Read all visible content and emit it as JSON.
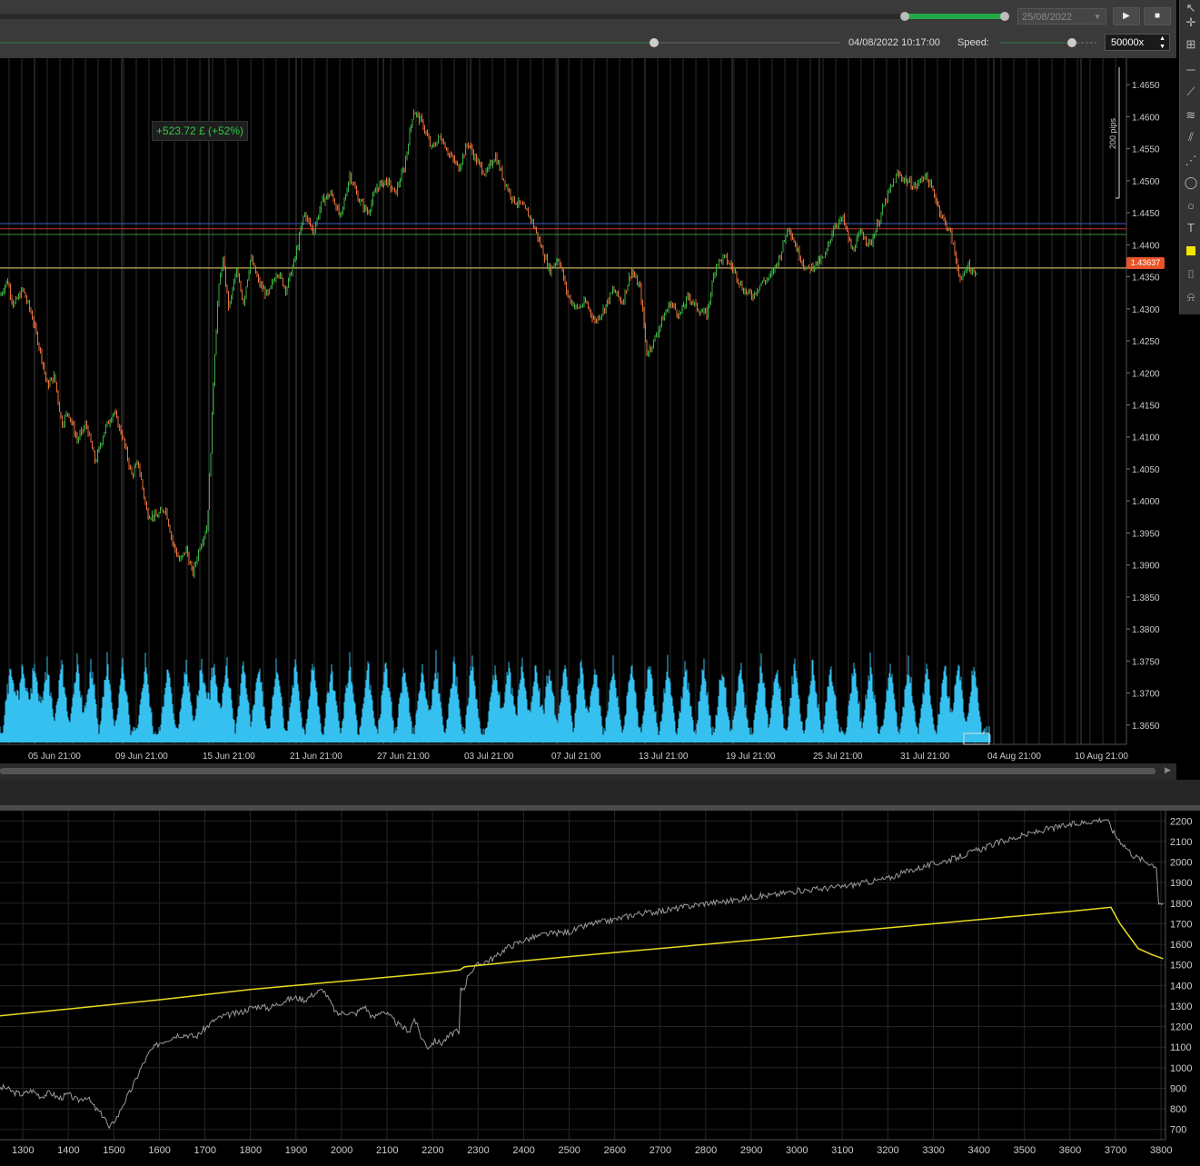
{
  "playback": {
    "end_date": "25/08/2022",
    "current_datetime": "04/08/2022 10:17:00",
    "speed_label": "Speed:",
    "speed_value": "50000x",
    "play_icon": "play-icon",
    "stop_icon": "stop-icon"
  },
  "trade_result": "+523.72 £ (+52%)",
  "price_chart": {
    "current_price": "1.43637",
    "pips_label": "200 pips",
    "y_ticks": [
      "1.4650",
      "1.4600",
      "1.4550",
      "1.4500",
      "1.4450",
      "1.4400",
      "1.4350",
      "1.4300",
      "1.4250",
      "1.4200",
      "1.4150",
      "1.4100",
      "1.4050",
      "1.4000",
      "1.3950",
      "1.3900",
      "1.3850",
      "1.3800",
      "1.3750",
      "1.3700",
      "1.3650"
    ],
    "x_ticks": [
      "05 Jun 21:00",
      "09 Jun 21:00",
      "15 Jun 21:00",
      "21 Jun 21:00",
      "27 Jun 21:00",
      "03 Jul 21:00",
      "07 Jul 21:00",
      "13 Jul 21:00",
      "19 Jul 21:00",
      "25 Jul 21:00",
      "31 Jul 21:00",
      "04 Aug 21:00",
      "10 Aug 21:00"
    ],
    "colors": {
      "up": "#3cb043",
      "down": "#e8703a",
      "volume": "#35c0ef",
      "blue_line": "#3f51b5",
      "red_line": "#c0392b",
      "green_line": "#3c8a3c",
      "price_line": "#c8b060"
    },
    "price_path": [
      [
        0,
        1.432
      ],
      [
        8,
        1.4345
      ],
      [
        15,
        1.4305
      ],
      [
        25,
        1.433
      ],
      [
        35,
        1.429
      ],
      [
        45,
        1.423
      ],
      [
        52,
        1.418
      ],
      [
        60,
        1.4195
      ],
      [
        68,
        1.412
      ],
      [
        75,
        1.414
      ],
      [
        85,
        1.4095
      ],
      [
        95,
        1.412
      ],
      [
        105,
        1.406
      ],
      [
        115,
        1.411
      ],
      [
        125,
        1.414
      ],
      [
        135,
        1.41
      ],
      [
        145,
        1.404
      ],
      [
        152,
        1.406
      ],
      [
        162,
        1.398
      ],
      [
        172,
        1.3975
      ],
      [
        182,
        1.399
      ],
      [
        190,
        1.3935
      ],
      [
        198,
        1.3905
      ],
      [
        205,
        1.3925
      ],
      [
        212,
        1.3885
      ],
      [
        220,
        1.393
      ],
      [
        228,
        1.396
      ],
      [
        232,
        1.408
      ],
      [
        236,
        1.422
      ],
      [
        240,
        1.432
      ],
      [
        245,
        1.438
      ],
      [
        252,
        1.43
      ],
      [
        260,
        1.436
      ],
      [
        268,
        1.431
      ],
      [
        276,
        1.438
      ],
      [
        285,
        1.434
      ],
      [
        295,
        1.432
      ],
      [
        305,
        1.436
      ],
      [
        315,
        1.433
      ],
      [
        325,
        1.438
      ],
      [
        335,
        1.445
      ],
      [
        345,
        1.442
      ],
      [
        355,
        1.447
      ],
      [
        365,
        1.448
      ],
      [
        375,
        1.444
      ],
      [
        385,
        1.451
      ],
      [
        395,
        1.447
      ],
      [
        405,
        1.445
      ],
      [
        415,
        1.449
      ],
      [
        425,
        1.45
      ],
      [
        435,
        1.448
      ],
      [
        445,
        1.452
      ],
      [
        455,
        1.461
      ],
      [
        465,
        1.459
      ],
      [
        475,
        1.455
      ],
      [
        485,
        1.457
      ],
      [
        495,
        1.454
      ],
      [
        505,
        1.452
      ],
      [
        515,
        1.456
      ],
      [
        525,
        1.453
      ],
      [
        535,
        1.451
      ],
      [
        545,
        1.454
      ],
      [
        555,
        1.45
      ],
      [
        565,
        1.447
      ],
      [
        575,
        1.446
      ],
      [
        585,
        1.444
      ],
      [
        595,
        1.44
      ],
      [
        605,
        1.436
      ],
      [
        615,
        1.438
      ],
      [
        625,
        1.432
      ],
      [
        635,
        1.43
      ],
      [
        645,
        1.431
      ],
      [
        655,
        1.428
      ],
      [
        665,
        1.43
      ],
      [
        675,
        1.433
      ],
      [
        685,
        1.431
      ],
      [
        695,
        1.436
      ],
      [
        705,
        1.433
      ],
      [
        712,
        1.423
      ],
      [
        720,
        1.425
      ],
      [
        728,
        1.428
      ],
      [
        738,
        1.431
      ],
      [
        748,
        1.429
      ],
      [
        758,
        1.432
      ],
      [
        768,
        1.43
      ],
      [
        778,
        1.429
      ],
      [
        788,
        1.437
      ],
      [
        798,
        1.438
      ],
      [
        808,
        1.436
      ],
      [
        818,
        1.433
      ],
      [
        828,
        1.432
      ],
      [
        838,
        1.434
      ],
      [
        848,
        1.435
      ],
      [
        858,
        1.438
      ],
      [
        868,
        1.443
      ],
      [
        878,
        1.439
      ],
      [
        888,
        1.436
      ],
      [
        898,
        1.437
      ],
      [
        908,
        1.438
      ],
      [
        918,
        1.443
      ],
      [
        928,
        1.444
      ],
      [
        938,
        1.439
      ],
      [
        948,
        1.442
      ],
      [
        958,
        1.44
      ],
      [
        968,
        1.444
      ],
      [
        978,
        1.448
      ],
      [
        988,
        1.451
      ],
      [
        998,
        1.45
      ],
      [
        1008,
        1.449
      ],
      [
        1018,
        1.451
      ],
      [
        1028,
        1.448
      ],
      [
        1038,
        1.444
      ],
      [
        1046,
        1.442
      ],
      [
        1052,
        1.438
      ],
      [
        1058,
        1.434
      ],
      [
        1065,
        1.437
      ],
      [
        1072,
        1.4355
      ],
      [
        1076,
        1.4364
      ]
    ],
    "volume_peaks": [
      12,
      25,
      38,
      52,
      68,
      85,
      100,
      118,
      135,
      160,
      185,
      205,
      222,
      235,
      250,
      268,
      285,
      305,
      325,
      345,
      365,
      385,
      405,
      425,
      445,
      465,
      480,
      500,
      520,
      545,
      560,
      575,
      590,
      605,
      622,
      640,
      655,
      675,
      695,
      715,
      735,
      755,
      775,
      795,
      815,
      838,
      855,
      875,
      895,
      915,
      940,
      958,
      980,
      1000,
      1020,
      1040,
      1055,
      1072
    ]
  },
  "equity_chart": {
    "x_ticks": [
      "1300",
      "1400",
      "1500",
      "1600",
      "1700",
      "1800",
      "1900",
      "2000",
      "2100",
      "2200",
      "2300",
      "2400",
      "2500",
      "2600",
      "2700",
      "2800",
      "2900",
      "3000",
      "3100",
      "3200",
      "3300",
      "3400",
      "3500",
      "3600",
      "3700",
      "3800"
    ],
    "y_ticks": [
      "2200",
      "2100",
      "2000",
      "1900",
      "1800",
      "1700",
      "1600",
      "1500",
      "1400",
      "1300",
      "1200",
      "1100",
      "1000",
      "900",
      "800",
      "700"
    ],
    "colors": {
      "equity": "#9a9a9a",
      "balance": "#e8dc20"
    },
    "equity_path": [
      [
        1240,
        890
      ],
      [
        1260,
        905
      ],
      [
        1280,
        880
      ],
      [
        1300,
        870
      ],
      [
        1320,
        890
      ],
      [
        1340,
        860
      ],
      [
        1360,
        880
      ],
      [
        1380,
        850
      ],
      [
        1400,
        870
      ],
      [
        1420,
        840
      ],
      [
        1440,
        860
      ],
      [
        1460,
        800
      ],
      [
        1480,
        760
      ],
      [
        1490,
        700
      ],
      [
        1500,
        740
      ],
      [
        1510,
        770
      ],
      [
        1520,
        820
      ],
      [
        1540,
        900
      ],
      [
        1560,
        1000
      ],
      [
        1580,
        1080
      ],
      [
        1600,
        1120
      ],
      [
        1620,
        1140
      ],
      [
        1640,
        1160
      ],
      [
        1660,
        1160
      ],
      [
        1680,
        1150
      ],
      [
        1700,
        1190
      ],
      [
        1720,
        1230
      ],
      [
        1740,
        1250
      ],
      [
        1760,
        1260
      ],
      [
        1780,
        1270
      ],
      [
        1800,
        1290
      ],
      [
        1820,
        1300
      ],
      [
        1840,
        1290
      ],
      [
        1860,
        1310
      ],
      [
        1880,
        1330
      ],
      [
        1900,
        1340
      ],
      [
        1920,
        1330
      ],
      [
        1940,
        1360
      ],
      [
        1960,
        1380
      ],
      [
        1970,
        1340
      ],
      [
        1990,
        1260
      ],
      [
        2010,
        1270
      ],
      [
        2030,
        1260
      ],
      [
        2050,
        1300
      ],
      [
        2070,
        1240
      ],
      [
        2090,
        1280
      ],
      [
        2110,
        1240
      ],
      [
        2130,
        1200
      ],
      [
        2150,
        1180
      ],
      [
        2160,
        1240
      ],
      [
        2175,
        1150
      ],
      [
        2190,
        1100
      ],
      [
        2205,
        1130
      ],
      [
        2220,
        1120
      ],
      [
        2235,
        1150
      ],
      [
        2250,
        1180
      ],
      [
        2258,
        1160
      ],
      [
        2262,
        1380
      ],
      [
        2270,
        1390
      ],
      [
        2280,
        1460
      ],
      [
        2300,
        1500
      ],
      [
        2320,
        1520
      ],
      [
        2340,
        1540
      ],
      [
        2360,
        1580
      ],
      [
        2380,
        1600
      ],
      [
        2400,
        1620
      ],
      [
        2450,
        1650
      ],
      [
        2500,
        1660
      ],
      [
        2550,
        1700
      ],
      [
        2600,
        1720
      ],
      [
        2650,
        1750
      ],
      [
        2700,
        1760
      ],
      [
        2750,
        1780
      ],
      [
        2800,
        1800
      ],
      [
        2850,
        1810
      ],
      [
        2900,
        1830
      ],
      [
        2950,
        1840
      ],
      [
        3000,
        1860
      ],
      [
        3050,
        1870
      ],
      [
        3100,
        1880
      ],
      [
        3150,
        1900
      ],
      [
        3200,
        1920
      ],
      [
        3250,
        1960
      ],
      [
        3300,
        1990
      ],
      [
        3350,
        2020
      ],
      [
        3400,
        2060
      ],
      [
        3450,
        2100
      ],
      [
        3500,
        2130
      ],
      [
        3550,
        2160
      ],
      [
        3600,
        2180
      ],
      [
        3650,
        2200
      ],
      [
        3680,
        2210
      ],
      [
        3700,
        2130
      ],
      [
        3720,
        2080
      ],
      [
        3740,
        2030
      ],
      [
        3770,
        2000
      ],
      [
        3790,
        1980
      ],
      [
        3795,
        1800
      ],
      [
        3805,
        1800
      ]
    ],
    "balance_path": [
      [
        1240,
        1250
      ],
      [
        1400,
        1285
      ],
      [
        1600,
        1330
      ],
      [
        1800,
        1380
      ],
      [
        2000,
        1420
      ],
      [
        2200,
        1460
      ],
      [
        2260,
        1475
      ],
      [
        2270,
        1490
      ],
      [
        2400,
        1520
      ],
      [
        2600,
        1560
      ],
      [
        2800,
        1600
      ],
      [
        3000,
        1640
      ],
      [
        3200,
        1680
      ],
      [
        3400,
        1720
      ],
      [
        3600,
        1760
      ],
      [
        3690,
        1780
      ],
      [
        3710,
        1700
      ],
      [
        3730,
        1640
      ],
      [
        3750,
        1580
      ],
      [
        3780,
        1550
      ],
      [
        3805,
        1530
      ]
    ]
  }
}
